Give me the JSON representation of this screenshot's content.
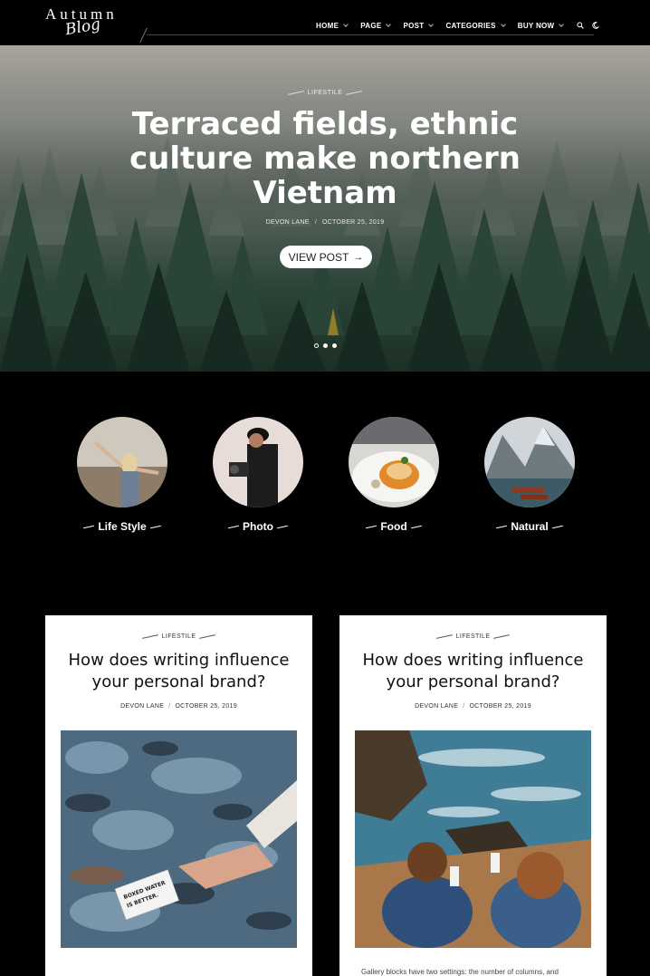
{
  "header": {
    "logo_top": "Autumn",
    "logo_script": "Blog",
    "nav": [
      {
        "label": "HOME"
      },
      {
        "label": "PAGE"
      },
      {
        "label": "POST"
      },
      {
        "label": "CATEGORIES"
      },
      {
        "label": "BUY NOW"
      }
    ],
    "icons": [
      "search-icon",
      "moon-icon"
    ]
  },
  "hero": {
    "category": "LIFESTILE",
    "title": "Terraced fields, ethnic culture make northern Vietnam",
    "author": "DEVON LANE",
    "date": "OCTOBER 25, 2019",
    "button_label": "VIEW POST",
    "slides": 3,
    "active_slide": 0
  },
  "categories": [
    {
      "label": "Life Style",
      "icon": "life-style-photo"
    },
    {
      "label": "Photo",
      "icon": "photographer-photo"
    },
    {
      "label": "Food",
      "icon": "food-plate-photo"
    },
    {
      "label": "Natural",
      "icon": "lake-mountain-photo"
    }
  ],
  "posts": [
    {
      "category": "LIFESTILE",
      "title": "How does writing influence your personal brand?",
      "author": "DEVON LANE",
      "date": "OCTOBER 25, 2019",
      "image_text": "BOXED WATER IS BETTER."
    },
    {
      "category": "LIFESTILE",
      "title": "How does writing influence your personal brand?",
      "author": "DEVON LANE",
      "date": "OCTOBER 25, 2019",
      "excerpt": "Gallery blocks have two settings: the number of columns, and"
    }
  ],
  "colors": {
    "background": "#000000",
    "card": "#ffffff",
    "text_dark": "#111111"
  }
}
